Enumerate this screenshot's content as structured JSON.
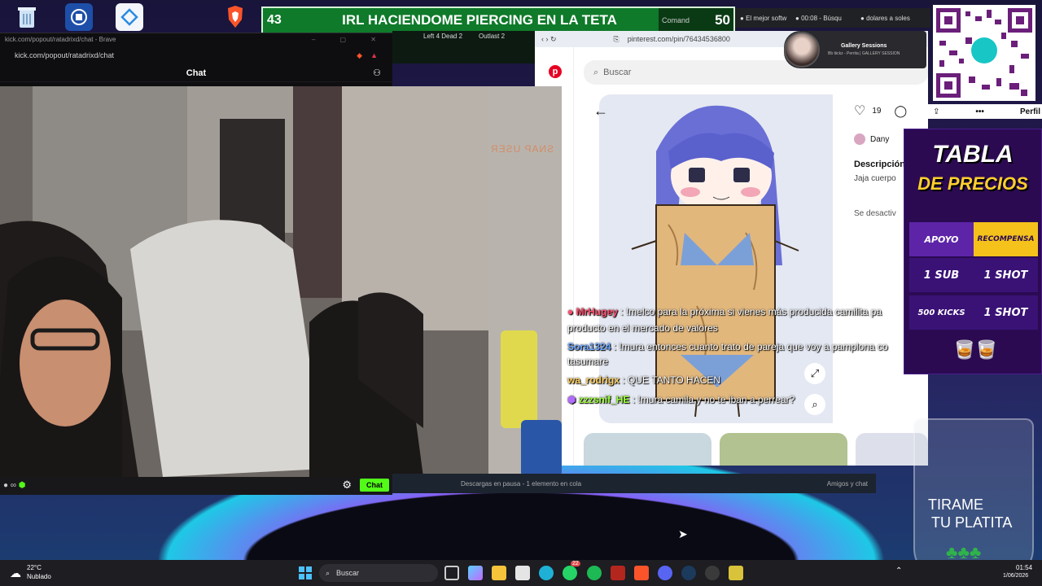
{
  "desktop": {
    "weather": {
      "temp": "22°C",
      "condition": "Nublado"
    }
  },
  "top_banner": {
    "left_number": "43",
    "title": "IRL HACIENDOME PIERCING EN LA TETA",
    "right_label": "Comand",
    "right_number": "50"
  },
  "browser_tabs": [
    {
      "label": "El mejor softw"
    },
    {
      "label": "00:08 - Búsqu"
    },
    {
      "label": "dolares a soles"
    }
  ],
  "chat_window": {
    "title": "kick.com/popout/ratadrixd/chat - Brave",
    "url": "kick.com/popout/ratadrixd/chat",
    "header": "Chat",
    "tabs_behind": [
      "Left 4 Dead 2",
      "Outlast 2"
    ],
    "chat_button": "Chat"
  },
  "webcam": {
    "watermark": "SNAP USER"
  },
  "pinterest": {
    "url": "pinterest.com/pin/76434536800",
    "search_placeholder": "Buscar",
    "likes": "19",
    "user": "Dany",
    "description_label": "Descripción",
    "description_text": "Jaja cuerpo",
    "muted_text": "Se desactiv",
    "profile_label": "Perfil"
  },
  "gallery_popup": {
    "title": "Gallery Sessions",
    "subtitle": "Bb tiickz - Perrita | GALLERY SESSION"
  },
  "chat_messages": [
    {
      "user": "MrHugey",
      "text": ": !melco para la próxima si vienes más producida camilita pa",
      "cont": "producto en el mercado de valores",
      "color": "#ff4d6d"
    },
    {
      "user": "Sora1324",
      "text": ": !mura entonces cuanto trato de pareja que voy a pamplona co",
      "cont": "tasumare",
      "color": "#6ea8ff"
    },
    {
      "user": "wa_rodrigx",
      "text": ": QUE TANTO HACEN",
      "cont": "",
      "color": "#ffd166"
    },
    {
      "user": "zzzsnif_HE",
      "text": ": !mura camila y no te iban a perrear?",
      "cont": "",
      "color": "#9dff3a"
    }
  ],
  "price_table": {
    "title_1": "TABLA",
    "title_2": "DE PRECIOS",
    "col_support": "APOYO",
    "col_reward": "RECOMPENSA",
    "rows": [
      {
        "support": "1 SUB",
        "reward": "1 SHOT"
      },
      {
        "support": "500 KICKS",
        "reward": "1 SHOT"
      }
    ]
  },
  "donation": {
    "line1": "TIRAME",
    "line2": "TU PLATITA"
  },
  "downloads_bar": {
    "status": "Descargas en pausa - 1 elemento en cola",
    "friends": "Amigos y chat"
  },
  "taskbar": {
    "search_placeholder": "Buscar",
    "badge_count": "22",
    "clock_time": "01:54",
    "clock_date": "1/06/2026"
  },
  "colors": {
    "kick_green": "#53fc18",
    "pinterest_red": "#e60023",
    "banner_green": "#0f7a2a"
  }
}
